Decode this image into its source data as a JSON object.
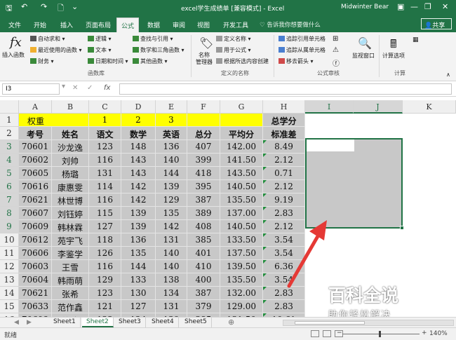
{
  "titlebar": {
    "title": "excel学生成绩单  [兼容模式] - Excel",
    "user": "Midwinter Bear",
    "minimize": "—",
    "restore": "❐",
    "close": "✕"
  },
  "ribbon_tabs": [
    "文件",
    "开始",
    "插入",
    "页面布局",
    "公式",
    "数据",
    "审阅",
    "视图",
    "开发工具"
  ],
  "tell_me": "♡ 告诉我你想要做什么",
  "share": "共享",
  "ribbon": {
    "insert_function": "插入函数",
    "lib_col1": [
      "自动求和 ▾",
      "最近使用的函数 ▾",
      "财务 ▾"
    ],
    "lib_col2": [
      "逻辑 ▾",
      "文本 ▾",
      "日期和时间 ▾"
    ],
    "lib_col3": [
      "查找与引用 ▾",
      "数学和三角函数 ▾",
      "其他函数 ▾"
    ],
    "group_library": "函数库",
    "name_manager": "名称\n管理器",
    "names_items": [
      "定义名称 ▾",
      "用于公式 ▾",
      "根据所选内容创建"
    ],
    "group_names": "定义的名称",
    "audit_items": [
      "追踪引用单元格",
      "追踪从属单元格",
      "移去箭头 ▾"
    ],
    "group_audit": "公式审核",
    "watch": "监视窗口",
    "calc_options": "计算选项",
    "group_calc": "计算"
  },
  "formula_bar": {
    "name_box": "I3",
    "cancel": "✕",
    "confirm": "✓",
    "fx": "fx",
    "content": ""
  },
  "columns": [
    "A",
    "B",
    "C",
    "D",
    "E",
    "F",
    "G",
    "H",
    "I",
    "J",
    "K"
  ],
  "row_numbers": [
    "1",
    "2",
    "3",
    "4",
    "5",
    "6",
    "7",
    "8",
    "9",
    "10",
    "11",
    "12",
    "13",
    "14",
    "15",
    "16"
  ],
  "sheet": {
    "row1": {
      "label": "权重",
      "c": "1",
      "d": "2",
      "e": "3",
      "h": "总学分"
    },
    "headers": [
      "考号",
      "姓名",
      "语文",
      "数学",
      "英语",
      "总分",
      "平均分",
      "标准差"
    ],
    "rows": [
      [
        "70601",
        "沙龙逸",
        "123",
        "148",
        "136",
        "407",
        "142.00",
        "8.49"
      ],
      [
        "70602",
        "刘帅",
        "116",
        "143",
        "140",
        "399",
        "141.50",
        "2.12"
      ],
      [
        "70605",
        "杨璐",
        "131",
        "143",
        "144",
        "418",
        "143.50",
        "0.71"
      ],
      [
        "70616",
        "康惠雯",
        "114",
        "142",
        "139",
        "395",
        "140.50",
        "2.12"
      ],
      [
        "70621",
        "林世博",
        "116",
        "142",
        "129",
        "387",
        "135.50",
        "9.19"
      ],
      [
        "70607",
        "刘钰婷",
        "115",
        "139",
        "135",
        "389",
        "137.00",
        "2.83"
      ],
      [
        "70609",
        "韩林霖",
        "127",
        "139",
        "142",
        "408",
        "140.50",
        "2.12"
      ],
      [
        "70612",
        "苑宇飞",
        "118",
        "136",
        "131",
        "385",
        "133.50",
        "3.54"
      ],
      [
        "70606",
        "李鉴学",
        "126",
        "135",
        "140",
        "401",
        "137.50",
        "3.54"
      ],
      [
        "70603",
        "王雪",
        "116",
        "144",
        "140",
        "410",
        "139.50",
        "6.36"
      ],
      [
        "70604",
        "韩雨萌",
        "129",
        "133",
        "138",
        "400",
        "135.50",
        "3.54"
      ],
      [
        "70621",
        "张希",
        "123",
        "130",
        "134",
        "387",
        "132.00",
        "2.83"
      ],
      [
        "70633",
        "范作鑫",
        "121",
        "127",
        "131",
        "379",
        "129.00",
        "2.83"
      ],
      [
        "70608",
        "徐冲",
        "122",
        "124",
        "139",
        "385",
        "131.50",
        "10.61"
      ]
    ]
  },
  "sheets": [
    "Sheet1",
    "Sheet2",
    "Sheet3",
    "Sheet4",
    "Sheet5"
  ],
  "active_sheet": "Sheet2",
  "status": {
    "ready": "就绪",
    "zoom": "140%",
    "zoom_minus": "−",
    "zoom_plus": "+"
  },
  "watermark": {
    "line1": "百科全说",
    "line2": "助你轻松解决"
  },
  "colors": {
    "excel_green": "#217346",
    "highlight_yellow": "#ffff00",
    "grey_fill": "#c8c8c8",
    "arrow_red": "#e53935"
  }
}
